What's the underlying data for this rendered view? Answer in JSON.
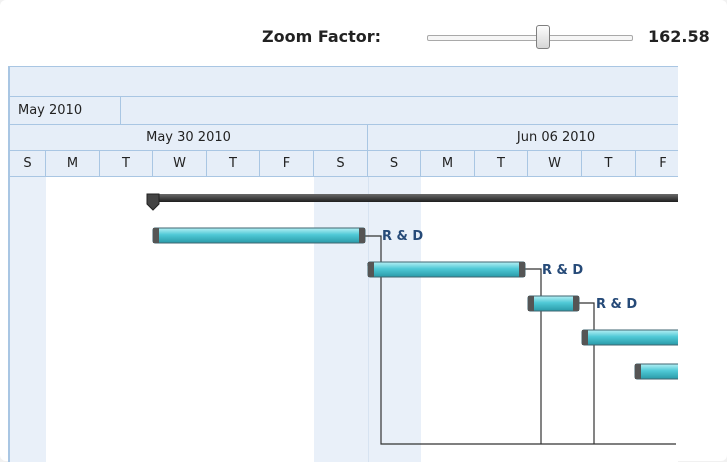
{
  "toolbar": {
    "zoom_label": "Zoom Factor:",
    "zoom_value": "162.58"
  },
  "timeline": {
    "month": "May 2010",
    "weeks": [
      "May 30 2010",
      "Jun 06 2010"
    ],
    "days": [
      "S",
      "M",
      "T",
      "W",
      "T",
      "F",
      "S",
      "S",
      "M",
      "T",
      "W",
      "T",
      "F"
    ]
  },
  "tasks": [
    {
      "label": "R & D"
    },
    {
      "label": "R & D"
    },
    {
      "label": "R & D"
    }
  ],
  "colors": {
    "bar": "#4fc9d6",
    "summary": "#333333",
    "header_bg": "#e6eef8",
    "weekend_shade": "#e9f0f9",
    "label": "#264a78"
  }
}
